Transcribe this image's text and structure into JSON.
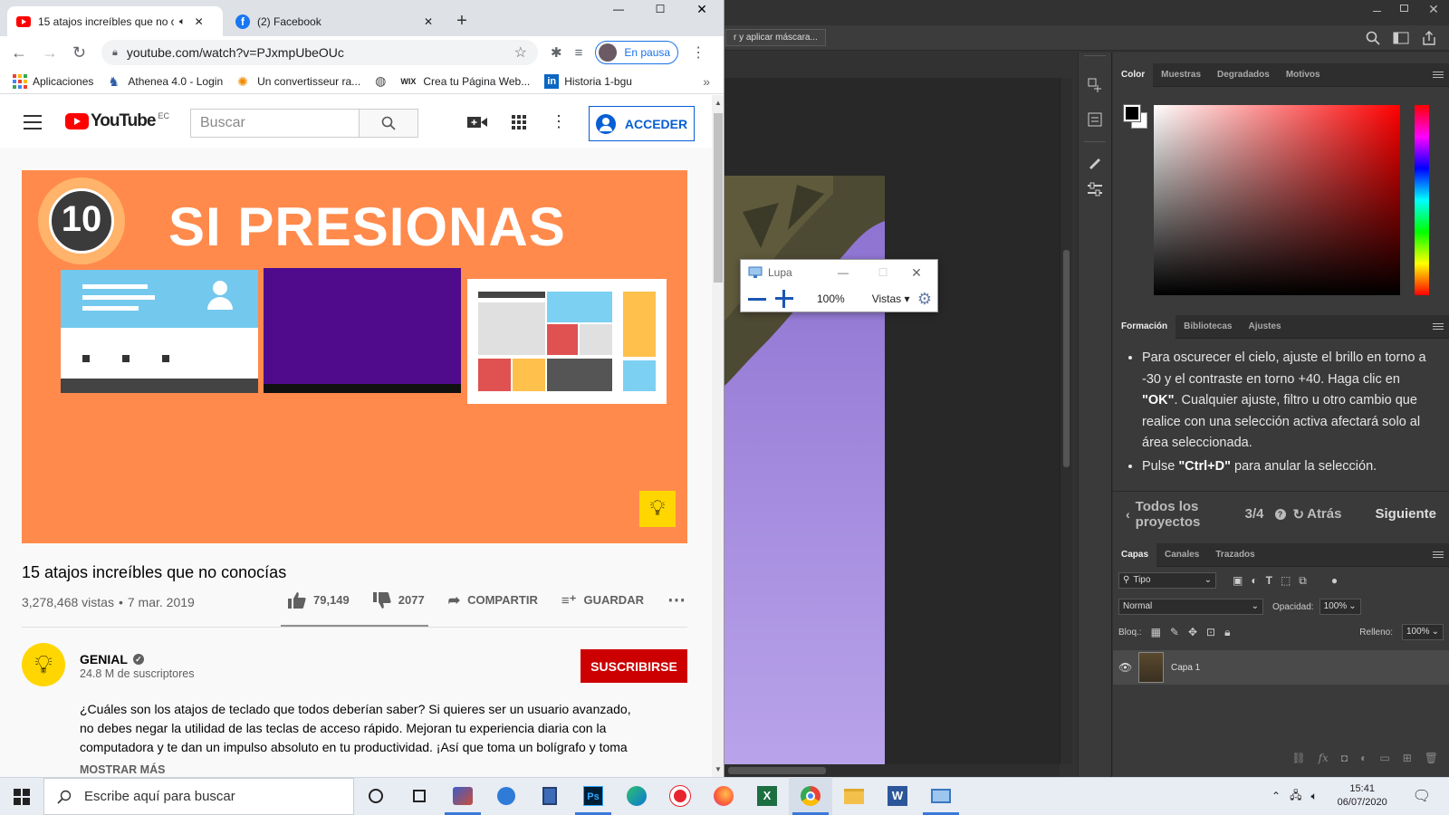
{
  "chrome": {
    "tabs": [
      {
        "title": "15 atajos increíbles que no c"
      },
      {
        "title": "(2) Facebook"
      }
    ],
    "new_tab_symbol": "+",
    "url": "youtube.com/watch?v=PJxmpUbeOUc",
    "profile_label": "En pausa",
    "bookmarks": [
      "Aplicaciones",
      "Athenea 4.0 - Login",
      "Un convertisseur ra...",
      "Crea tu Página Web...",
      "Historia 1-bgu"
    ],
    "bookmark_prefix_wix": "WIX",
    "bookmarks_more": "»"
  },
  "youtube": {
    "logo_text": "YouTube",
    "region": "EC",
    "search_placeholder": "Buscar",
    "signin_label": "ACCEDER",
    "thumbnail": {
      "number": "10",
      "headline": "SI PRESIONAS"
    },
    "video_title": "15 atajos increíbles que no conocías",
    "views": "3,278,468 vistas",
    "date": "7 mar. 2019",
    "likes": "79,149",
    "dislikes": "2077",
    "share_label": "COMPARTIR",
    "save_label": "GUARDAR",
    "channel": {
      "name": "GENIAL",
      "subscribers": "24.8 M de suscriptores",
      "subscribe_label": "SUSCRIBIRSE"
    },
    "description": "¿Cuáles son los atajos de teclado que todos deberían saber? Si quieres ser un usuario avanzado, no debes negar la utilidad de las teclas de acceso rápido. Mejoran tu experiencia diaria con la computadora y te dan un impulso absoluto en tu productividad. ¡Así que toma un bolígrafo y toma",
    "show_more": "MOSTRAR MÁS"
  },
  "photoshop": {
    "option_button": "r y aplicar máscara...",
    "color_tabs": [
      "Color",
      "Muestras",
      "Degradados",
      "Motivos"
    ],
    "learn_tabs": [
      "Formación",
      "Bibliotecas",
      "Ajustes"
    ],
    "learn_bullets": [
      [
        {
          "t": "Para oscurecer el cielo, ajuste el brillo en torno a -30 y el contraste en torno +40. Haga clic en ",
          "b": false
        },
        {
          "t": "\"OK\"",
          "b": true
        },
        {
          "t": ". Cualquier ajuste, filtro u otro cambio que realice con una selección activa afectará solo al área seleccionada.",
          "b": false
        }
      ],
      [
        {
          "t": "Pulse ",
          "b": false
        },
        {
          "t": "\"Ctrl+D\"",
          "b": true
        },
        {
          "t": " para anular la selección.",
          "b": false
        }
      ]
    ],
    "learn_nav": {
      "all_projects": "Todos los proyectos",
      "step": "3/4",
      "back": "Atrás",
      "next": "Siguiente"
    },
    "layer_tabs": [
      "Capas",
      "Canales",
      "Trazados"
    ],
    "filter_kind": "Tipo",
    "blend_mode": "Normal",
    "opacity_label": "Opacidad:",
    "opacity_value": "100%",
    "lock_label": "Bloq.:",
    "fill_label": "Relleno:",
    "fill_value": "100%",
    "layer_name": "Capa 1",
    "fx_label": "fx"
  },
  "magnifier": {
    "title": "Lupa",
    "zoom": "100%",
    "views_label": "Vistas"
  },
  "taskbar": {
    "search_placeholder": "Escribe aquí para buscar",
    "time": "15:41",
    "date": "06/07/2020",
    "apps": [
      "photoshop-app",
      "word-app",
      "excel-app"
    ],
    "ps_label": "Ps",
    "excel_label": "X",
    "word_label": "W"
  },
  "colors": {
    "youtube_red": "#ff0000",
    "subscribe_red": "#cc0000",
    "link_blue": "#065fd4",
    "thumb_orange": "#ff8a4c",
    "ps_panel": "#3a3a3a"
  }
}
